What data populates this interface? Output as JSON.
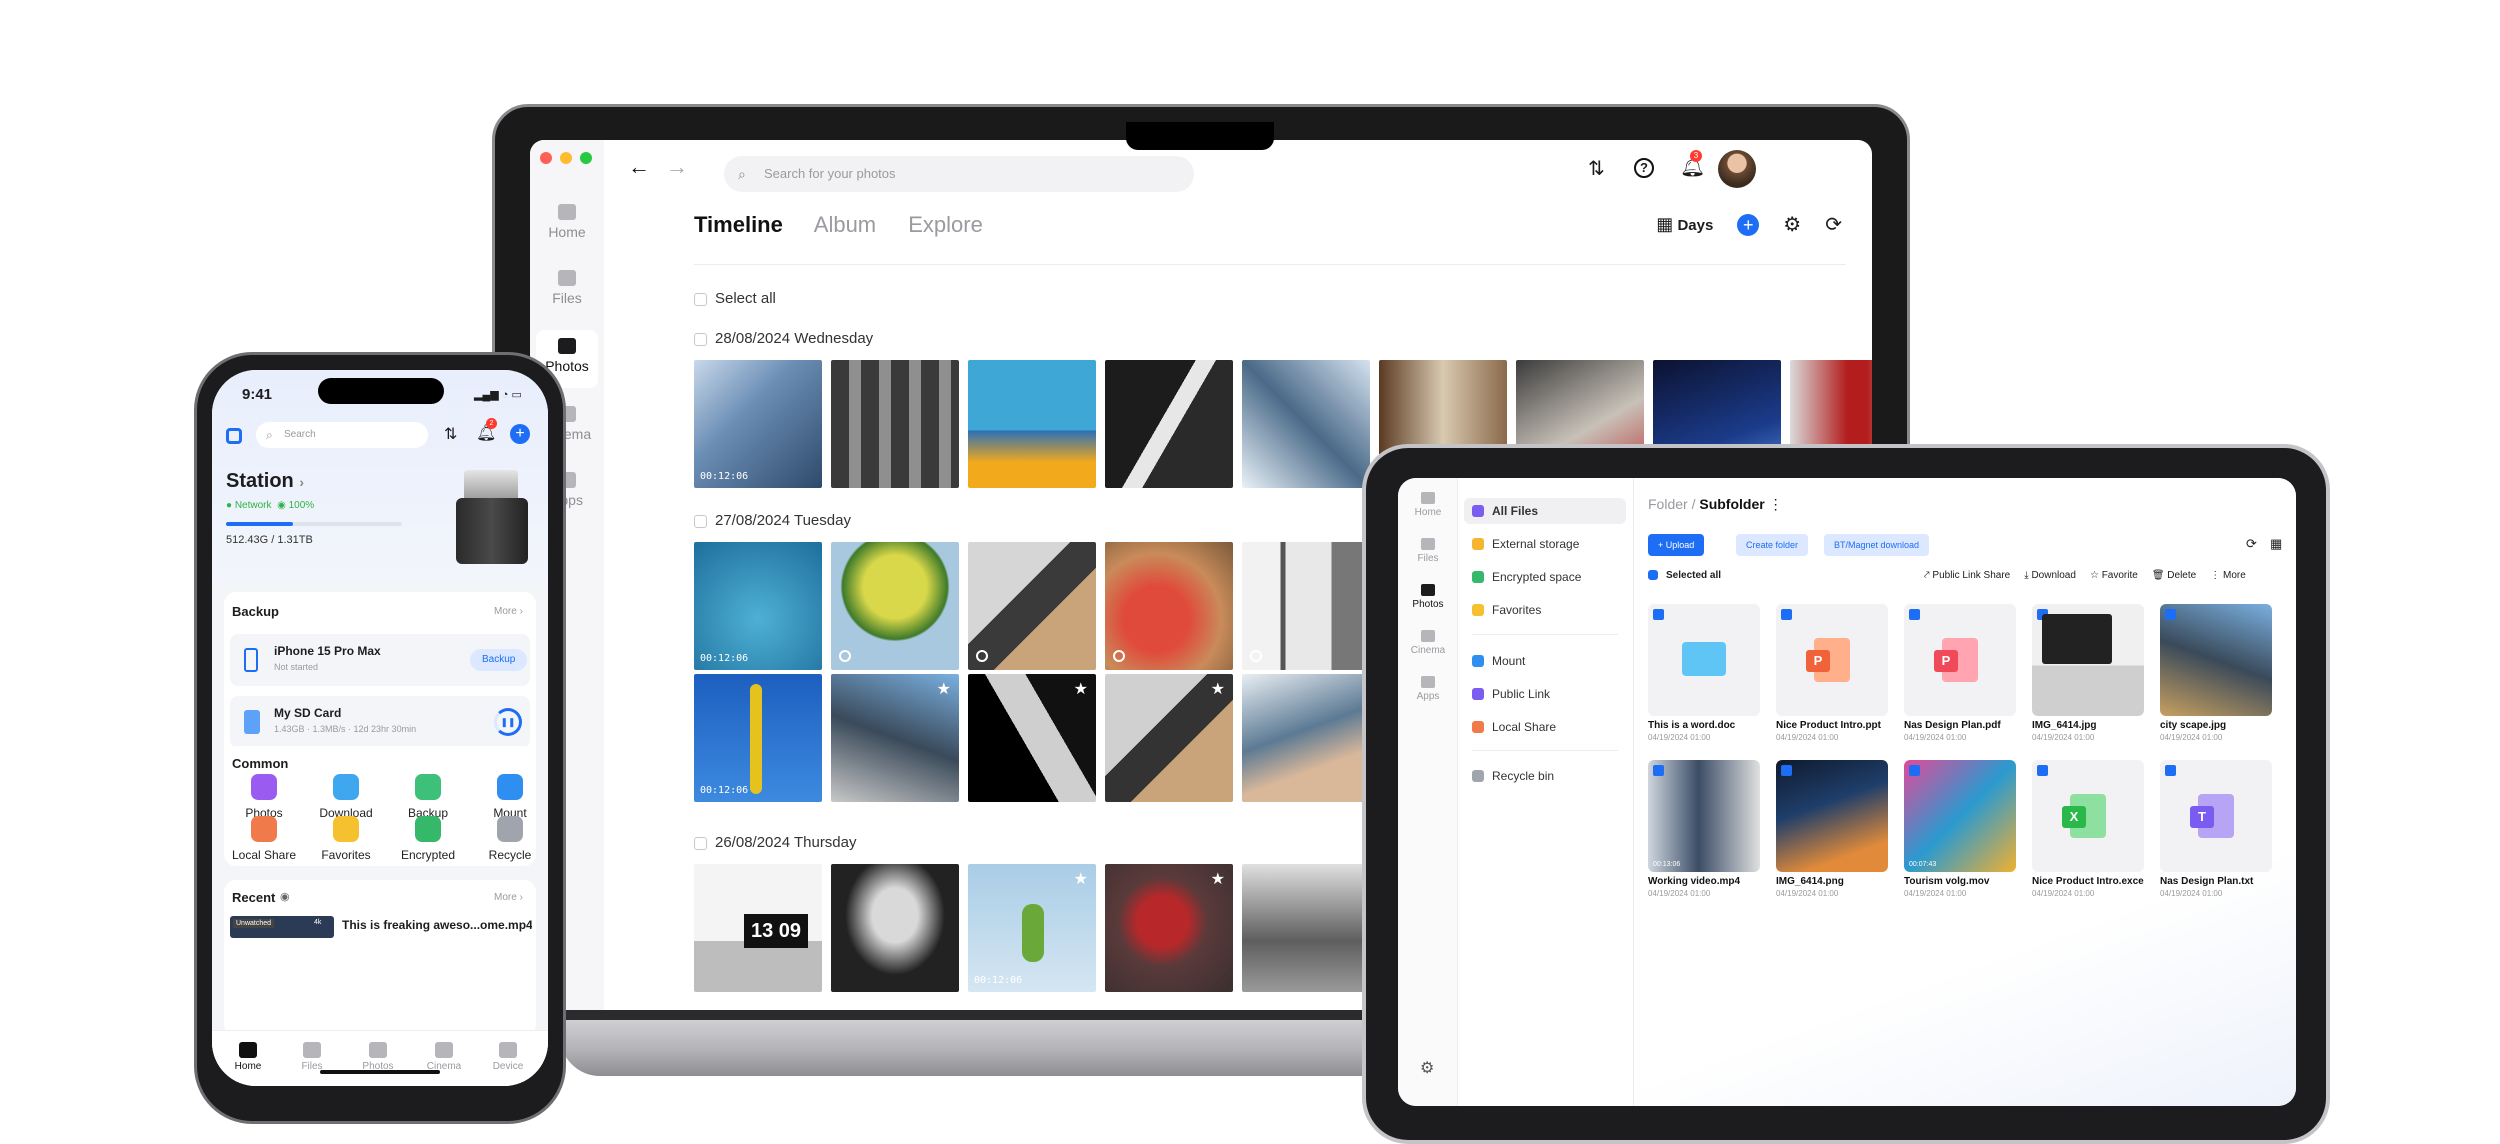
{
  "laptop": {
    "sidebar": [
      "Home",
      "Files",
      "Photos",
      "Cinema",
      "Apps"
    ],
    "search_placeholder": "Search for your photos",
    "notification_count": "3",
    "tabs": [
      "Timeline",
      "Album",
      "Explore"
    ],
    "days_label": "Days",
    "select_all": "Select all",
    "groups": [
      {
        "date": "28/08/2024 Wednesday"
      },
      {
        "date": "27/08/2024 Tuesday"
      },
      {
        "date": "26/08/2024 Thursday"
      }
    ],
    "durations": [
      "00:12:06",
      "00:12:06",
      "00:12:06",
      "00:12:06"
    ],
    "clock_text": "13 09"
  },
  "phone": {
    "time": "9:41",
    "search_placeholder": "Search",
    "notification_count": "2",
    "station": {
      "title": "Station",
      "network": "Network",
      "battery": "100%",
      "storage": "512.43G / 1.31TB"
    },
    "backup": {
      "title": "Backup",
      "more": "More",
      "device": "iPhone 15 Pro Max",
      "device_status": "Not started",
      "backup_btn": "Backup",
      "sd": "My SD Card",
      "sd_status": "1.43GB · 1.3MB/s · 12d 23hr 30min"
    },
    "common": {
      "title": "Common",
      "items": [
        "Photos",
        "Download",
        "Backup",
        "Mount",
        "Local Share",
        "Favorites",
        "Encrypted",
        "Recycle"
      ]
    },
    "recent": {
      "title": "Recent",
      "more": "More",
      "badge": "Unwatched",
      "badge2": "4k",
      "file": "This is freaking aweso...ome.mp4"
    },
    "tabbar": [
      "Home",
      "Files",
      "Photos",
      "Cinema",
      "Device"
    ]
  },
  "tablet": {
    "rail": [
      "Home",
      "Files",
      "Photos",
      "Cinema",
      "Apps"
    ],
    "nav": [
      "All Files",
      "External storage",
      "Encrypted space",
      "Favorites",
      "Mount",
      "Public Link",
      "Local Share",
      "Recycle bin"
    ],
    "breadcrumb_root": "Folder",
    "breadcrumb_sep": "/",
    "breadcrumb_current": "Subfolder",
    "buttons": {
      "upload": "+ Upload",
      "create": "Create folder",
      "bt": "BT/Magnet download"
    },
    "selected_all": "Selected all",
    "actions": [
      "Public Link Share",
      "Download",
      "Favorite",
      "Delete",
      "More"
    ],
    "files": [
      {
        "name": "This is a word.doc",
        "date": "04/19/2024 01:00"
      },
      {
        "name": "Nice Product Intro.ppt",
        "date": "04/19/2024 01:00"
      },
      {
        "name": "Nas Design Plan.pdf",
        "date": "04/19/2024 01:00"
      },
      {
        "name": "IMG_6414.jpg",
        "date": "04/19/2024 01:00"
      },
      {
        "name": "city scape.jpg",
        "date": "04/19/2024 01:00"
      },
      {
        "name": "Working video.mp4",
        "date": "04/19/2024 01:00"
      },
      {
        "name": "IMG_6414.png",
        "date": "04/19/2024 01:00"
      },
      {
        "name": "Tourism volg.mov",
        "date": "04/19/2024 01:00"
      },
      {
        "name": "Nice Product Intro.excel",
        "date": "04/19/2024 01:00"
      },
      {
        "name": "Nas Design Plan.txt",
        "date": "04/19/2024 01:00"
      }
    ],
    "video_durations": [
      "00:13:06",
      "00:07:43"
    ]
  }
}
